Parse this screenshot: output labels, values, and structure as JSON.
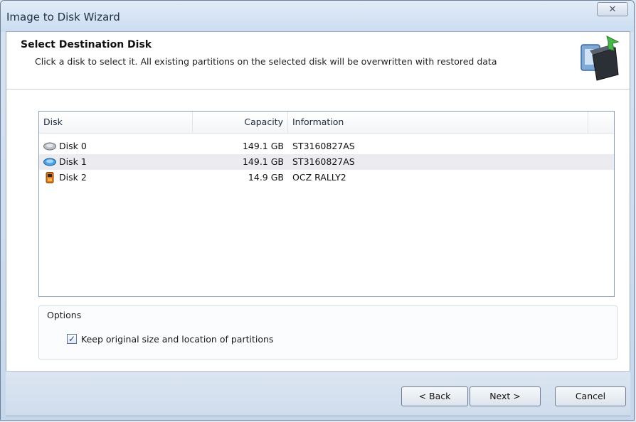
{
  "window": {
    "title": "Image to Disk Wizard",
    "close_glyph": "✕"
  },
  "header": {
    "title": "Select Destination Disk",
    "subtitle": "Click a disk to select it. All existing partitions on the selected disk will be overwritten with restored data",
    "icon": "disk-wizard-icon"
  },
  "disk_list": {
    "columns": {
      "disk": "Disk",
      "capacity": "Capacity",
      "information": "Information"
    },
    "rows": [
      {
        "name": "Disk 0",
        "capacity": "149.1 GB",
        "information": "ST3160827AS",
        "icon": "hard-disk-icon",
        "color": "#b9bec4"
      },
      {
        "name": "Disk 1",
        "capacity": "149.1 GB",
        "information": "ST3160827AS",
        "icon": "hard-disk-icon",
        "color": "#4aa3e8"
      },
      {
        "name": "Disk 2",
        "capacity": "14.9 GB",
        "information": "OCZ RALLY2",
        "icon": "usb-drive-icon",
        "color": "#e07a1c"
      }
    ]
  },
  "options": {
    "group_label": "Options",
    "keep_partitions_label": "Keep original size and location of partitions",
    "keep_partitions_checked": true
  },
  "buttons": {
    "back": "< Back",
    "next": "Next >",
    "cancel": "Cancel"
  }
}
